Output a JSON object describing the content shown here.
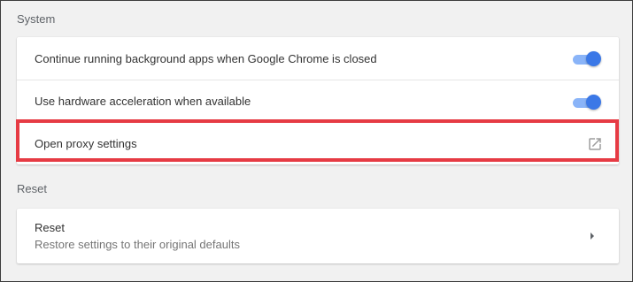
{
  "system": {
    "title": "System",
    "rows": [
      {
        "label": "Continue running background apps when Google Chrome is closed",
        "toggle_on": true
      },
      {
        "label": "Use hardware acceleration when available",
        "toggle_on": true
      },
      {
        "label": "Open proxy settings",
        "icon": "external-link-icon"
      }
    ]
  },
  "reset": {
    "title": "Reset",
    "row": {
      "label": "Reset",
      "sublabel": "Restore settings to their original defaults",
      "icon": "chevron-right-icon"
    }
  },
  "colors": {
    "toggle_track": "#8ab4f8",
    "toggle_knob": "#3b78e7",
    "highlight": "#e63b44"
  }
}
